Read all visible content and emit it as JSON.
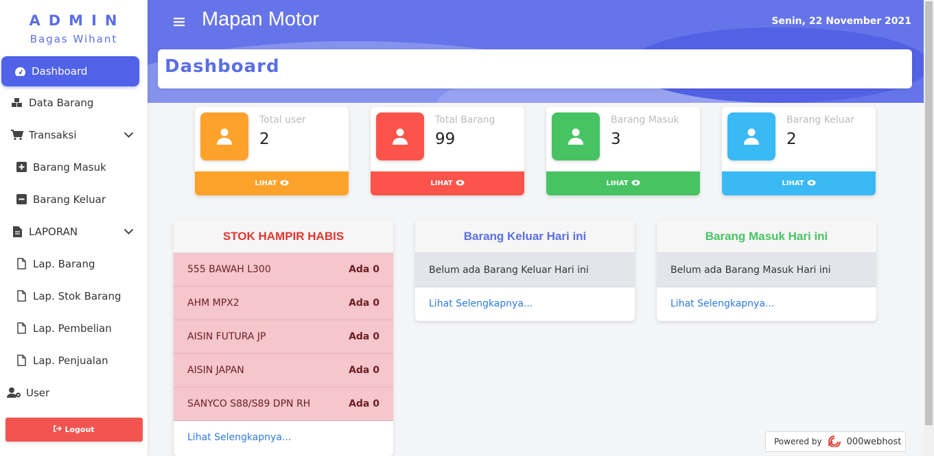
{
  "sidebar": {
    "brand": "ADMIN",
    "username": "Bagas Wihant",
    "items": [
      {
        "label": "Dashboard",
        "icon": "dashboard-icon"
      },
      {
        "label": "Data Barang",
        "icon": "cubes-icon"
      },
      {
        "label": "Transaksi",
        "icon": "cart-icon"
      },
      {
        "label": "Barang Masuk",
        "icon": "plus-square-icon"
      },
      {
        "label": "Barang Keluar",
        "icon": "minus-square-icon"
      },
      {
        "label": "LAPORAN",
        "icon": "document-icon"
      },
      {
        "label": "Lap. Barang",
        "icon": "file-icon"
      },
      {
        "label": "Lap. Stok Barang",
        "icon": "file-icon"
      },
      {
        "label": "Lap. Pembelian",
        "icon": "file-icon"
      },
      {
        "label": "Lap. Penjualan",
        "icon": "file-icon"
      },
      {
        "label": "User",
        "icon": "users-cog-icon"
      }
    ],
    "logout_label": "Logout"
  },
  "header": {
    "title": "Mapan Motor",
    "date": "Senin, 22 November 2021"
  },
  "page_title": "Dashboard",
  "stats": [
    {
      "label": "Total user",
      "value": "2",
      "action": "LIHAT",
      "color": "#fea22b"
    },
    {
      "label": "Total Barang",
      "value": "99",
      "action": "LIHAT",
      "color": "#fc544b"
    },
    {
      "label": "Barang Masuk",
      "value": "3",
      "action": "LIHAT",
      "color": "#47c363"
    },
    {
      "label": "Barang Keluar",
      "value": "2",
      "action": "LIHAT",
      "color": "#3abaf4"
    }
  ],
  "stock_panel": {
    "title": "STOK HAMPIR HABIS",
    "title_color": "#e3342f",
    "rows": [
      {
        "name": "555 BAWAH L300",
        "amount": "Ada 0"
      },
      {
        "name": "AHM MPX2",
        "amount": "Ada 0"
      },
      {
        "name": "AISIN FUTURA JP",
        "amount": "Ada 0"
      },
      {
        "name": "AISIN JAPAN",
        "amount": "Ada 0"
      },
      {
        "name": "SANYCO S88/S89 DPN RH",
        "amount": "Ada 0"
      }
    ],
    "more": "Lihat Selengkapnya..."
  },
  "out_panel": {
    "title": "Barang Keluar Hari ini",
    "title_color": "#5a6ee6",
    "empty": "Belum ada Barang Keluar Hari ini",
    "more": "Lihat Selengkapnya..."
  },
  "in_panel": {
    "title": "Barang Masuk Hari ini",
    "title_color": "#47c363",
    "empty": "Belum ada Barang Masuk Hari ini",
    "more": "Lihat Selengkapnya..."
  },
  "powered": {
    "prefix": "Powered by",
    "host": "000webhost"
  }
}
